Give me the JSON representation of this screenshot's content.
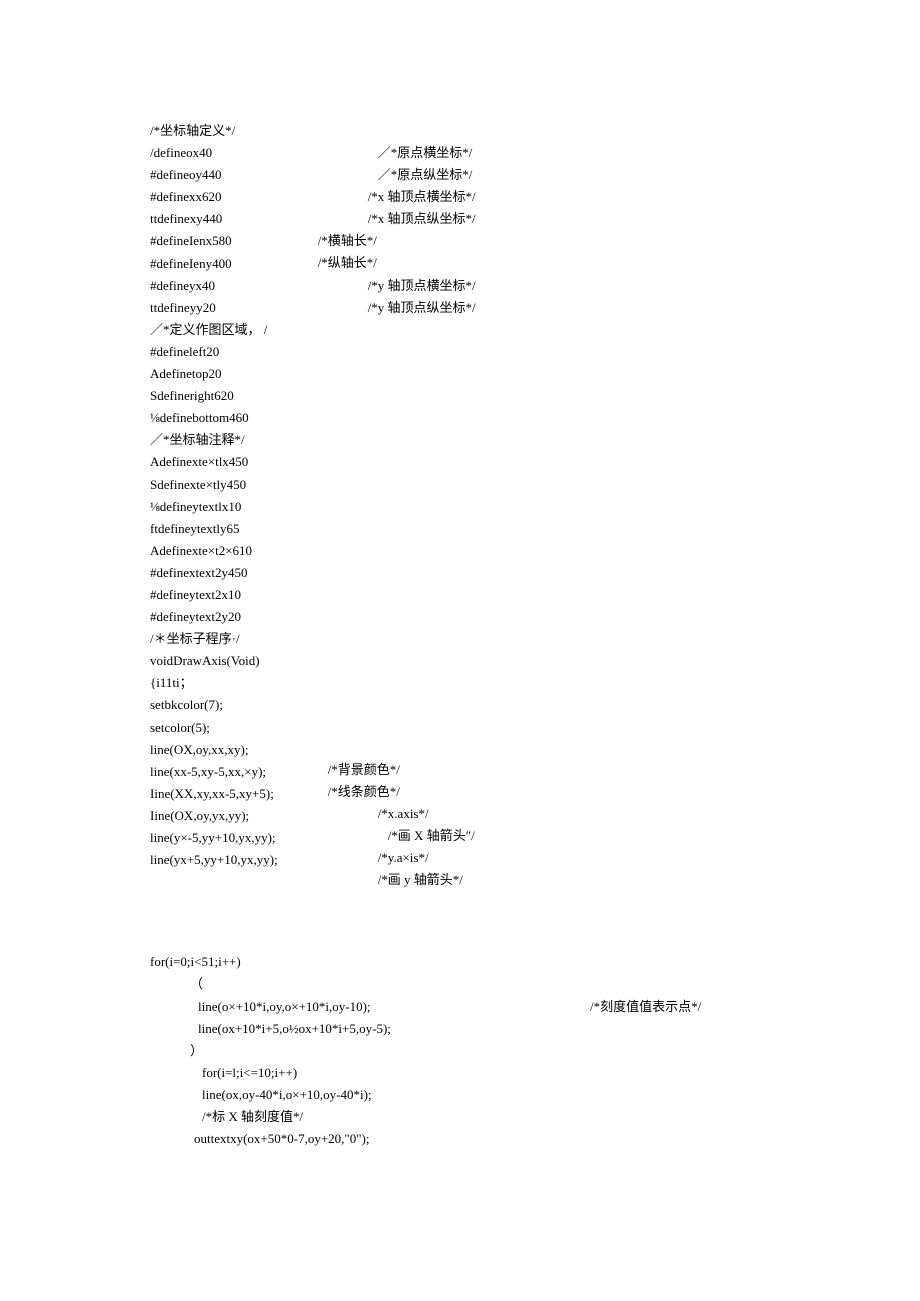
{
  "section1": {
    "left": [
      "/*坐标轴定义*/",
      "/defineox40",
      "#defineoy440",
      "#definexx620",
      "ttdefinexy440",
      "#defineIenx580",
      "#defineIeny400",
      "#defineyx40",
      "ttdefineyy20",
      "／*定义作图区域， /",
      "#defineleft20",
      "Adefinetop20",
      "Sdefineright620",
      "⅛definebottom460",
      "／*坐标轴注释*/",
      "Adefinexte×tlx450",
      "Sdefinexte×tly450",
      "⅛defineytextlx10",
      "ftdefineytextly65",
      "Adefinexte×t2×610",
      "#definextext2y450",
      "#defineytext2x10",
      "#defineytext2y20",
      "/＊坐标子程序·/",
      "voidDrawAxis(Void)",
      "{i11ti；",
      "setbkcolor(7);",
      "setcolor(5);",
      "line(OX,oy,xx,xy);",
      "line(xx-5,xy-5,xx,×y);",
      "Iine(XX,xy,xx-5,xy+5);",
      "Iine(OX,oy,yx,yy);",
      "line(y×-5,yy+10,yx,yy);",
      "line(yx+5,yy+10,yx,yy);"
    ],
    "right": [
      "／*原点横坐标*/",
      "／*原点纵坐标*/",
      "/*x 轴顶点横坐标*/",
      "/*x 轴顶点纵坐标*/",
      "/*横轴长*/",
      "/*纵轴长*/",
      "/*y 轴顶点横坐标*/",
      "/*y 轴顶点纵坐标*/"
    ],
    "right2": [
      "/*背景颜色*/",
      "/*线条颜色*/",
      "/*x.axis*/",
      "/*画 X 轴箭头″/",
      "",
      "/*y.a×is*/",
      "/*画 y 轴箭头*/"
    ]
  },
  "section2": {
    "lines": [
      "for(i=0;i<51;i++)",
      "（",
      "line(o×+10*i,oy,o×+10*i,oy-10);",
      "line(ox+10*i+5,o½ox+10*i+5,oy-5);",
      "）",
      "for(i=l;i<=10;i++)",
      "line(ox,oy-40*i,o×+10,oy-40*i);",
      "/*标 X 轴刻度值*/",
      "outtextxy(ox+50*0-7,oy+20,\"0\");"
    ],
    "comment": "/*刻度值值表示点*/"
  }
}
